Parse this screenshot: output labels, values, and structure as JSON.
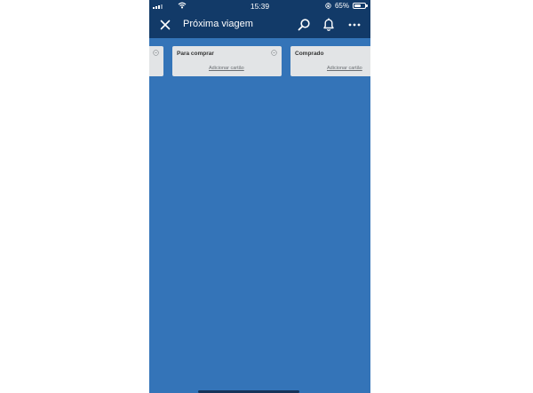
{
  "status_bar": {
    "time": "15:39",
    "battery_percent": "65%",
    "battery_level": 0.65
  },
  "app_bar": {
    "title": "Próxima viagem",
    "icons": [
      "close-icon",
      "search-icon",
      "bell-icon",
      "more-icon"
    ]
  },
  "board": {
    "background_color": "#3474b8",
    "lists": [
      {
        "title": "Para comprar",
        "add_card_label": "Adicionar cartão"
      },
      {
        "title": "Comprado",
        "add_card_label": "Adicionar cartão"
      }
    ]
  }
}
